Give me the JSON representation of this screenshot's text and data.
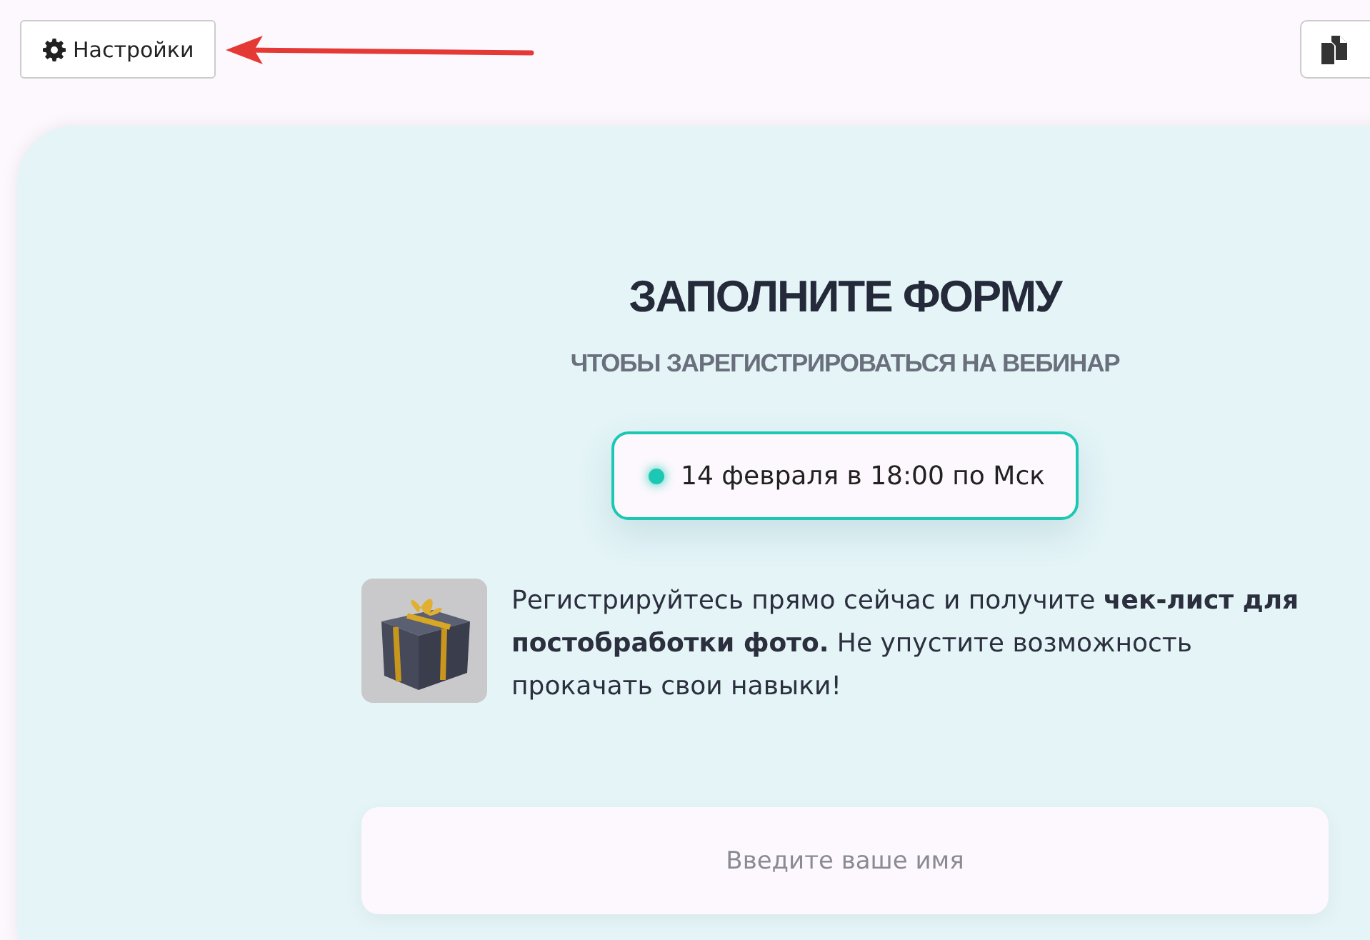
{
  "toolbar": {
    "settings_button": "Настройки"
  },
  "form": {
    "title": "ЗАПОЛНИТЕ ФОРМУ",
    "subtitle": "ЧТОБЫ ЗАРЕГИСТРИРОВАТЬСЯ НА ВЕБИНАР",
    "date_badge": {
      "text": "14 февраля в 18:00 по Мск",
      "color": "#1cc8b4"
    },
    "promo_text": "Регистрируйтесь прямо сейчас и получите **чек-лист для постобработки фото.** Не упустите возможность прокачать свои навыки!",
    "name_field": {
      "placeholder": "Введите ваше имя"
    }
  }
}
